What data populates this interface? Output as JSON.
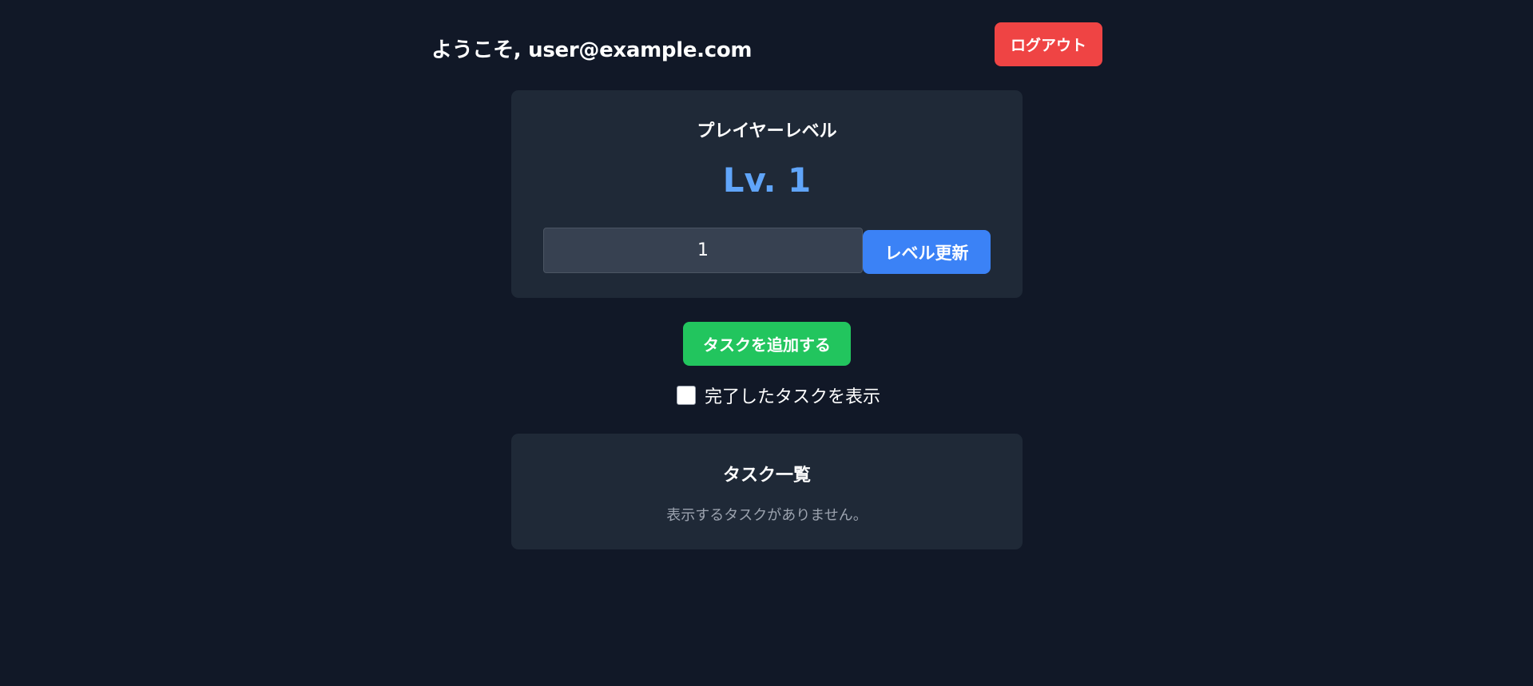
{
  "header": {
    "welcome_text": "ようこそ, user@example.com",
    "logout_label": "ログアウト"
  },
  "level_card": {
    "title": "プレイヤーレベル",
    "level_display": "Lv. 1",
    "level_input_value": "1",
    "update_button_label": "レベル更新"
  },
  "actions": {
    "add_task_label": "タスクを追加する",
    "show_completed_label": "完了したタスクを表示",
    "show_completed_checked": false
  },
  "task_list": {
    "title": "タスク一覧",
    "empty_message": "表示するタスクがありません。"
  },
  "colors": {
    "background": "#111827",
    "card": "#1f2937",
    "logout": "#ef4444",
    "update": "#3b82f6",
    "add_task": "#22c55e",
    "level_accent": "#60a5fa"
  }
}
